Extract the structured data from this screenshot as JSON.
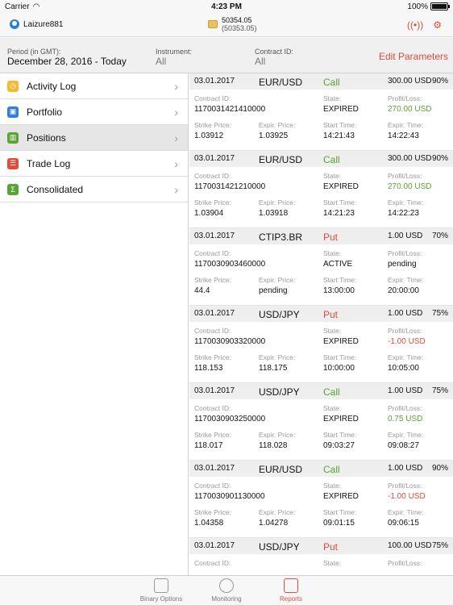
{
  "status": {
    "carrier": "Carrier",
    "time": "4:23 PM",
    "battery": "100%"
  },
  "header": {
    "username": "Laizure881",
    "balance": "50354.05",
    "balance_sub": "(50353.05)"
  },
  "filters": {
    "period_label": "Period (in GMT):",
    "period_value": "December 28, 2016 - Today",
    "instrument_label": "Instrument:",
    "instrument_value": "All",
    "contract_label": "Contract ID:",
    "contract_value": "All",
    "edit_label": "Edit Parameters"
  },
  "sidebar": {
    "items": [
      {
        "label": "Activity Log",
        "icon": "clock-icon",
        "color": "#f5b92e",
        "glyph": "◷"
      },
      {
        "label": "Portfolio",
        "icon": "briefcase-icon",
        "color": "#2f7fd8",
        "glyph": "▣"
      },
      {
        "label": "Positions",
        "icon": "chart-icon",
        "color": "#5aa332",
        "glyph": "▥"
      },
      {
        "label": "Trade Log",
        "icon": "list-icon",
        "color": "#e24b3b",
        "glyph": "☰"
      },
      {
        "label": "Consolidated",
        "icon": "sigma-icon",
        "color": "#5aa332",
        "glyph": "Σ"
      }
    ]
  },
  "labels": {
    "contract_id": "Contract ID:",
    "state": "State:",
    "profit_loss": "Profit/Loss:",
    "strike_price": "Strike Price:",
    "expir_price": "Expir. Price:",
    "start_time": "Start Time:",
    "expir_time": "Expir. Time:"
  },
  "trades": [
    {
      "date": "03.01.2017",
      "instrument": "EUR/USD",
      "type": "Call",
      "amount": "300.00 USD",
      "pct": "90%",
      "contract_id": "1170031421410000",
      "state": "EXPIRED",
      "pl": "270.00 USD",
      "pl_class": "green",
      "strike": "1.03912",
      "expir_price": "1.03925",
      "start": "14:21:43",
      "expir_time": "14:22:43"
    },
    {
      "date": "03.01.2017",
      "instrument": "EUR/USD",
      "type": "Call",
      "amount": "300.00 USD",
      "pct": "90%",
      "contract_id": "1170031421210000",
      "state": "EXPIRED",
      "pl": "270.00 USD",
      "pl_class": "green",
      "strike": "1.03904",
      "expir_price": "1.03918",
      "start": "14:21:23",
      "expir_time": "14:22:23"
    },
    {
      "date": "03.01.2017",
      "instrument": "CTIP3.BR",
      "type": "Put",
      "amount": "1.00 USD",
      "pct": "70%",
      "contract_id": "1170030903460000",
      "state": "ACTIVE",
      "pl": "pending",
      "pl_class": "gray",
      "strike": "44.4",
      "expir_price": "pending",
      "start": "13:00:00",
      "expir_time": "20:00:00"
    },
    {
      "date": "03.01.2017",
      "instrument": "USD/JPY",
      "type": "Put",
      "amount": "1.00 USD",
      "pct": "75%",
      "contract_id": "1170030903320000",
      "state": "EXPIRED",
      "pl": "-1.00 USD",
      "pl_class": "red",
      "strike": "118.153",
      "expir_price": "118.175",
      "start": "10:00:00",
      "expir_time": "10:05:00"
    },
    {
      "date": "03.01.2017",
      "instrument": "USD/JPY",
      "type": "Call",
      "amount": "1.00 USD",
      "pct": "75%",
      "contract_id": "1170030903250000",
      "state": "EXPIRED",
      "pl": "0.75 USD",
      "pl_class": "green",
      "strike": "118.017",
      "expir_price": "118.028",
      "start": "09:03:27",
      "expir_time": "09:08:27"
    },
    {
      "date": "03.01.2017",
      "instrument": "EUR/USD",
      "type": "Call",
      "amount": "1.00 USD",
      "pct": "90%",
      "contract_id": "1170030901130000",
      "state": "EXPIRED",
      "pl": "-1.00 USD",
      "pl_class": "red",
      "strike": "1.04358",
      "expir_price": "1.04278",
      "start": "09:01:15",
      "expir_time": "09:06:15"
    },
    {
      "date": "03.01.2017",
      "instrument": "USD/JPY",
      "type": "Put",
      "amount": "100.00 USD",
      "pct": "75%",
      "contract_id": "",
      "state": "",
      "pl": "",
      "pl_class": "red",
      "strike": "",
      "expir_price": "",
      "start": "",
      "expir_time": ""
    }
  ],
  "tabs": [
    {
      "label": "Binary Options",
      "icon": "binary-options-icon"
    },
    {
      "label": "Monitoring",
      "icon": "monitoring-icon"
    },
    {
      "label": "Reports",
      "icon": "reports-icon"
    }
  ],
  "colors": {
    "accent": "#e24b3b",
    "profit": "#5aa332"
  }
}
